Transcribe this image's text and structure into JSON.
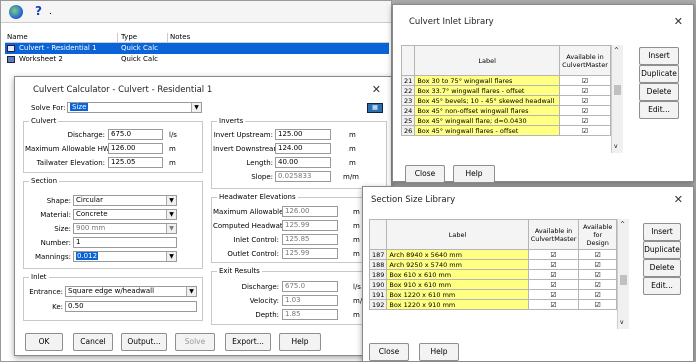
{
  "toolbar": {
    "globe_icon": "globe-icon",
    "help_icon": "help-icon",
    "dot": "."
  },
  "project_tree": {
    "columns": [
      "Name",
      "Type",
      "Notes"
    ],
    "rows": [
      {
        "name": "Culvert - Residential 1",
        "type": "Quick Calc",
        "selected": true
      },
      {
        "name": "Worksheet 2",
        "type": "Quick Calc",
        "selected": false
      }
    ]
  },
  "calc": {
    "title": "Culvert Calculator - Culvert - Residential 1",
    "solve_for_label": "Solve For:",
    "solve_for_value": "Size",
    "culvert": {
      "title": "Culvert",
      "discharge_label": "Discharge:",
      "discharge_value": "675.0",
      "discharge_unit": "l/s",
      "max_hw_label": "Maximum Allowable HW:",
      "max_hw_value": "126.00",
      "max_hw_unit": "m",
      "tw_label": "Tailwater Elevation:",
      "tw_value": "125.05",
      "tw_unit": "m"
    },
    "inverts": {
      "title": "Inverts",
      "up_label": "Invert Upstream:",
      "up_value": "125.00",
      "up_unit": "m",
      "down_label": "Invert Downstream:",
      "down_value": "124.00",
      "down_unit": "m",
      "length_label": "Length:",
      "length_value": "40.00",
      "length_unit": "m",
      "slope_label": "Slope:",
      "slope_value": "0.025833",
      "slope_unit": "m/m"
    },
    "section": {
      "title": "Section",
      "shape_label": "Shape:",
      "shape_value": "Circular",
      "material_label": "Material:",
      "material_value": "Concrete",
      "size_label": "Size:",
      "size_value": "900 mm",
      "number_label": "Number:",
      "number_value": "1",
      "mannings_label": "Mannings:",
      "mannings_value": "0.012"
    },
    "headwater": {
      "title": "Headwater Elevations",
      "max_label": "Maximum Allowable:",
      "max_value": "126.00",
      "max_unit": "m",
      "computed_label": "Computed Headwater:",
      "computed_value": "125.99",
      "computed_unit": "m",
      "inlet_label": "Inlet Control:",
      "inlet_value": "125.85",
      "inlet_unit": "m",
      "outlet_label": "Outlet Control:",
      "outlet_value": "125.99",
      "outlet_unit": "m"
    },
    "inlet": {
      "title": "Inlet",
      "entrance_label": "Entrance:",
      "entrance_value": "Square edge w/headwall",
      "ke_label": "Ke:",
      "ke_value": "0.50"
    },
    "exit": {
      "title": "Exit Results",
      "discharge_label": "Discharge:",
      "discharge_value": "675.0",
      "discharge_unit": "l/s",
      "velocity_label": "Velocity:",
      "velocity_value": "1.03",
      "velocity_unit": "m/s",
      "depth_label": "Depth:",
      "depth_value": "1.85",
      "depth_unit": "m"
    },
    "buttons": {
      "ok": "OK",
      "cancel": "Cancel",
      "output": "Output...",
      "solve": "Solve",
      "export": "Export...",
      "help": "Help"
    }
  },
  "inlet_lib": {
    "title": "Culvert Inlet Library",
    "col_label": "Label",
    "col_available": "Available in CulvertMaster",
    "rows": [
      {
        "num": "21",
        "label": "Box 30 to 75° wingwall flares"
      },
      {
        "num": "22",
        "label": "Box 33.7° wingwall flares - offset"
      },
      {
        "num": "23",
        "label": "Box 45° bevels; 10 - 45° skewed headwall"
      },
      {
        "num": "24",
        "label": "Box 45° non-offset wingwall flares"
      },
      {
        "num": "25",
        "label": "Box 45° wingwall flare; d=0.0430"
      },
      {
        "num": "26",
        "label": "Box 45° wingwall flares - offset"
      }
    ],
    "buttons": {
      "insert": "Insert",
      "duplicate": "Duplicate",
      "delete": "Delete",
      "edit": "Edit...",
      "close": "Close",
      "help": "Help"
    }
  },
  "size_lib": {
    "title": "Section Size Library",
    "col_label": "Label",
    "col_avail_cm": "Available in CulvertMaster",
    "col_avail_design": "Available for Design",
    "rows": [
      {
        "num": "187",
        "label": "Arch 8940 x 5640 mm"
      },
      {
        "num": "188",
        "label": "Arch 9250 x 5740 mm"
      },
      {
        "num": "189",
        "label": "Box 610 x 610 mm"
      },
      {
        "num": "190",
        "label": "Box 910 x 610 mm"
      },
      {
        "num": "191",
        "label": "Box 1220 x 610 mm"
      },
      {
        "num": "192",
        "label": "Box 1220 x 910 mm"
      }
    ],
    "buttons": {
      "insert": "Insert",
      "duplicate": "Duplicate",
      "delete": "Delete",
      "edit": "Edit...",
      "close": "Close",
      "help": "Help"
    }
  },
  "colors": {
    "selection": "#0a64d8",
    "highlight_cell": "#ffff82"
  }
}
